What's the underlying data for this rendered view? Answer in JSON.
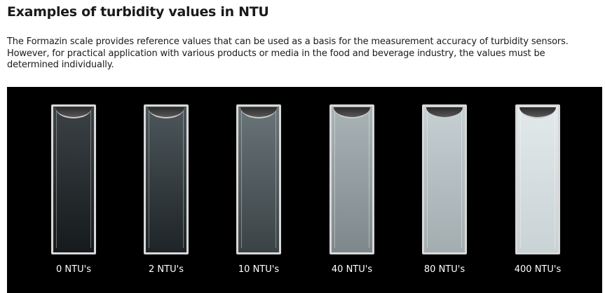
{
  "heading": "Examples of turbidity values in NTU",
  "intro": "The Formazin scale provides reference values that can be used as a basis for the measurement accuracy of turbidity sensors. However, for practical application with various products or media in the food and beverage industry, the values must be determined individually.",
  "samples": [
    {
      "label": "0 NTU's",
      "fill_top": "#3b4246",
      "fill_bottom": "#161a1c"
    },
    {
      "label": "2 NTU's",
      "fill_top": "#4d575b",
      "fill_bottom": "#1e2427"
    },
    {
      "label": "10 NTU's",
      "fill_top": "#6a7579",
      "fill_bottom": "#3a4245"
    },
    {
      "label": "40 NTU's",
      "fill_top": "#aab4b7",
      "fill_bottom": "#7e888b"
    },
    {
      "label": "80 NTU's",
      "fill_top": "#c6d0d3",
      "fill_bottom": "#a3adb0"
    },
    {
      "label": "400 NTU's",
      "fill_top": "#e2e9eb",
      "fill_bottom": "#c9d2d5"
    }
  ]
}
